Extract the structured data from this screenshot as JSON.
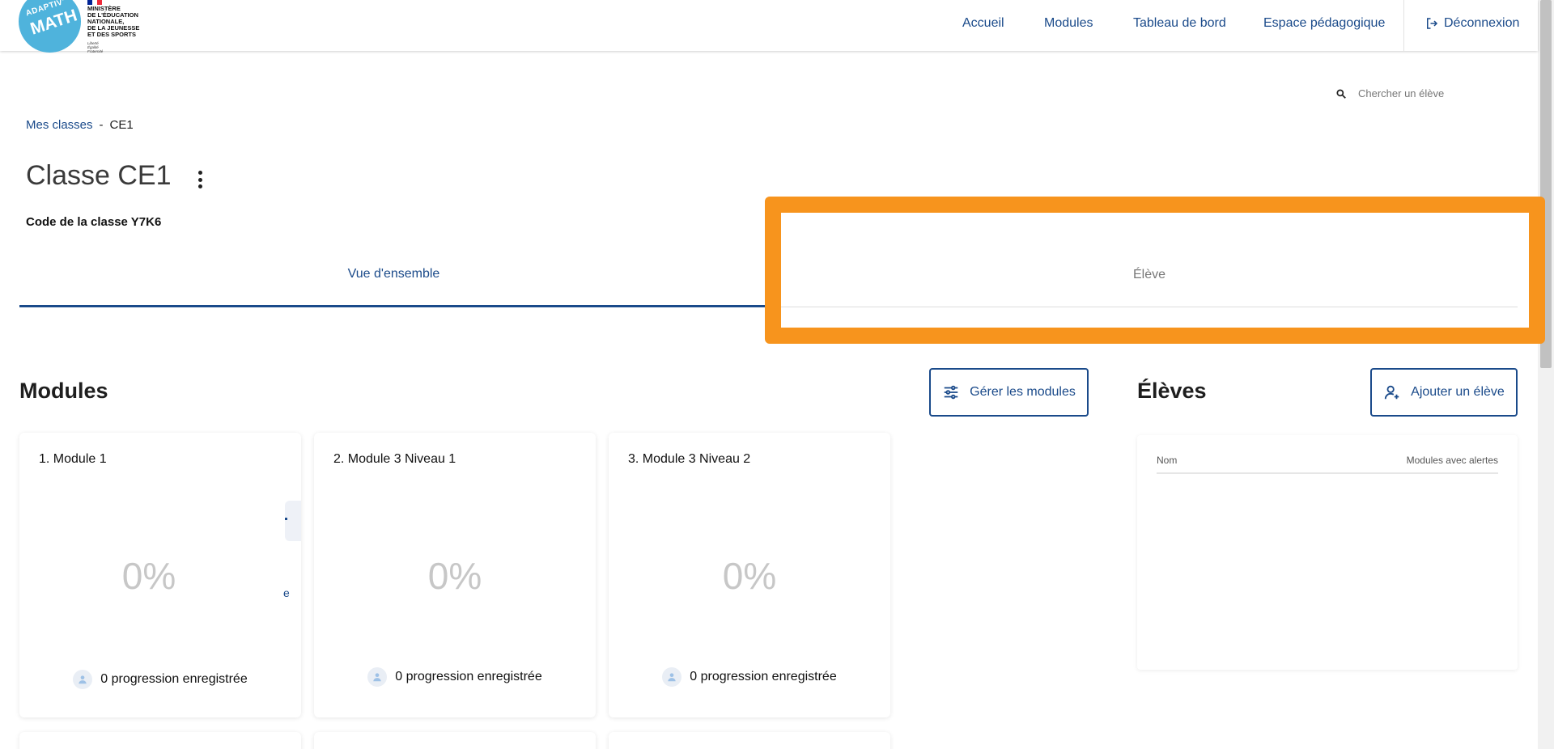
{
  "header": {
    "logo_line1": "ADAPTIV'",
    "logo_line2": "MATH",
    "ministry_lines": [
      "MINISTÈRE",
      "DE L'ÉDUCATION",
      "NATIONALE,",
      "DE LA JEUNESSE",
      "ET DES SPORTS"
    ],
    "motto_lines": [
      "Liberté",
      "Égalité",
      "Fraternité"
    ],
    "nav": [
      "Accueil",
      "Modules",
      "Tableau de bord",
      "Espace pédagogique"
    ],
    "logout_label": "Déconnexion"
  },
  "search": {
    "placeholder": "Chercher un élève"
  },
  "breadcrumb": {
    "parent": "Mes classes",
    "separator": "-",
    "current": "CE1"
  },
  "page": {
    "title": "Classe CE1",
    "class_code": "Code de la classe Y7K6"
  },
  "tabs": [
    {
      "label": "Vue d'ensemble",
      "active": true
    },
    {
      "label": "Élève",
      "active": false
    }
  ],
  "modules_section": {
    "title": "Modules",
    "manage_button": "Gérer les modules",
    "cards": [
      {
        "title": "1. Module 1",
        "percent": "0%",
        "footer": "0 progression enregistrée"
      },
      {
        "title": "2. Module 3 Niveau 1",
        "percent": "0%",
        "footer": "0 progression enregistrée"
      },
      {
        "title": "3. Module 3 Niveau 2",
        "percent": "0%",
        "footer": "0 progression enregistrée"
      }
    ]
  },
  "students_section": {
    "title": "Élèves",
    "add_button": "Ajouter un élève",
    "col_name": "Nom",
    "col_alerts": "Modules avec alertes"
  },
  "colors": {
    "primary": "#1a4a8a",
    "highlight": "#f7941d",
    "logo": "#4fb3dc"
  }
}
